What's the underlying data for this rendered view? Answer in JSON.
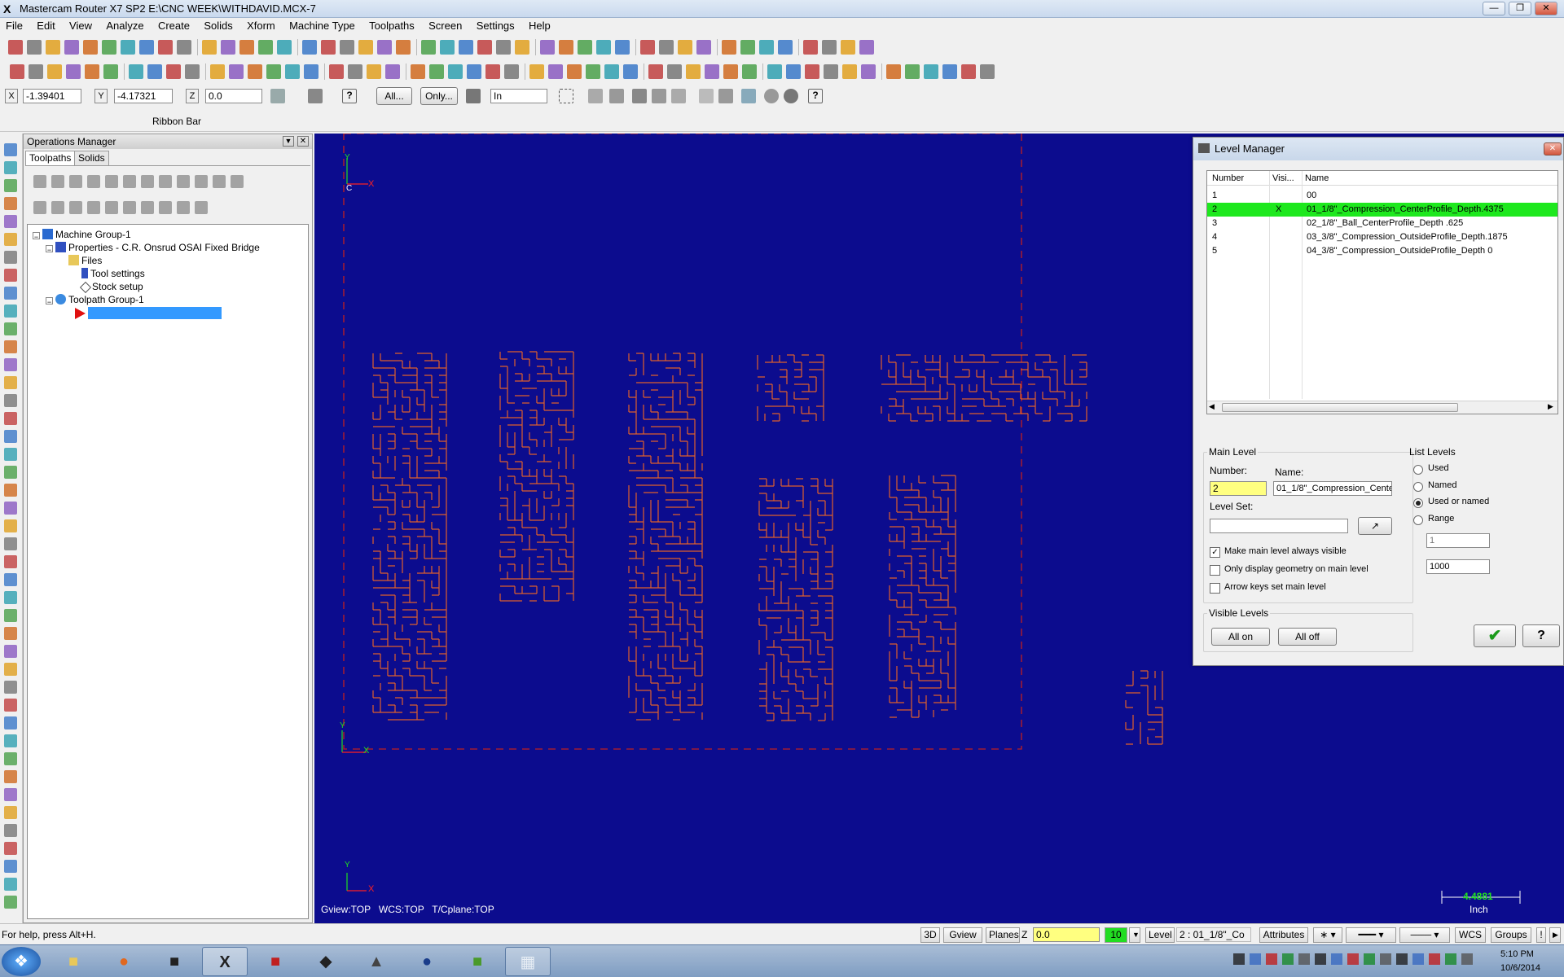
{
  "window": {
    "title": "Mastercam Router X7 SP2  E:\\CNC WEEK\\WITHDAVID.MCX-7"
  },
  "menu": [
    "File",
    "Edit",
    "View",
    "Analyze",
    "Create",
    "Solids",
    "Xform",
    "Machine Type",
    "Toolpaths",
    "Screen",
    "Settings",
    "Help"
  ],
  "coords": {
    "x_label": "X",
    "x_value": "-1.39401",
    "y_label": "Y",
    "y_value": "-4.17321",
    "z_label": "Z",
    "z_value": "0.0"
  },
  "autocursor": {
    "all_label": "All...",
    "only_label": "Only...",
    "units": "In"
  },
  "ribbon": {
    "label": "Ribbon Bar"
  },
  "ops_manager": {
    "title": "Operations Manager",
    "tabs": [
      "Toolpaths",
      "Solids"
    ],
    "tree": {
      "machine_group": "Machine Group-1",
      "properties": "Properties - C.R. Onsrud OSAI Fixed Bridge",
      "files": "Files",
      "tool_settings": "Tool settings",
      "stock_setup": "Stock setup",
      "toolpath_group": "Toolpath Group-1"
    }
  },
  "graphics": {
    "status_text": "Gview:TOP   WCS:TOP   T/Cplane:TOP",
    "scale_value": "4.4881",
    "scale_unit": "Inch",
    "axis_y": "Y",
    "axis_x": "X",
    "axis_c": "C",
    "colors": {
      "background": "#0c0c8e",
      "geometry": "#e0602a",
      "axis_x": "#ff2020",
      "axis_y": "#20e020"
    }
  },
  "level_manager": {
    "title": "Level Manager",
    "columns": [
      "Number",
      "Visi...",
      "Name"
    ],
    "rows": [
      {
        "number": "1",
        "visible": "",
        "name": "00"
      },
      {
        "number": "2",
        "visible": "X",
        "name": "01_1/8\"_Compression_CenterProfile_Depth.4375"
      },
      {
        "number": "3",
        "visible": "",
        "name": "02_1/8\"_Ball_CenterProfile_Depth .625"
      },
      {
        "number": "4",
        "visible": "",
        "name": "03_3/8\"_Compression_OutsideProfile_Depth.1875"
      },
      {
        "number": "5",
        "visible": "",
        "name": "04_3/8\"_Compression_OutsideProfile_Depth 0"
      }
    ],
    "main_level": {
      "group_label": "Main Level",
      "number_label": "Number:",
      "number_value": "2",
      "name_label": "Name:",
      "name_value": "01_1/8\"_Compression_Center",
      "level_set_label": "Level Set:",
      "level_set_value": ""
    },
    "options": [
      "Make main level always visible",
      "Only display geometry on main level",
      "Arrow keys set main level"
    ],
    "list_levels": {
      "group_label": "List Levels",
      "options": [
        "Used",
        "Named",
        "Used or named",
        "Range"
      ],
      "selected": "Used or named",
      "range_from": "1",
      "range_to": "1000"
    },
    "visible_levels": {
      "group_label": "Visible Levels",
      "all_on": "All on",
      "all_off": "All off"
    }
  },
  "statusbar": {
    "help_text": "For help, press Alt+H.",
    "items": [
      "3D",
      "Gview",
      "Planes"
    ],
    "z_label": "Z",
    "z_value": "0.0",
    "color_value": "10",
    "level_label": "Level",
    "level_value": "2 : 01_1/8\"_Co",
    "attributes": "Attributes",
    "wcs": "WCS",
    "groups": "Groups"
  },
  "taskbar": {
    "time": "5:10 PM",
    "date": "10/6/2014"
  }
}
